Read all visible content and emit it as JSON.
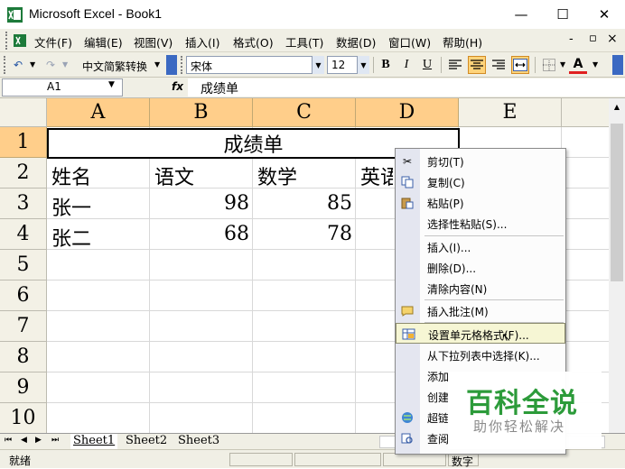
{
  "window": {
    "title": "Microsoft Excel - Book1",
    "min_glyph": "—",
    "max_glyph": "☐",
    "close_glyph": "✕"
  },
  "menu": {
    "items": [
      "文件(F)",
      "编辑(E)",
      "视图(V)",
      "插入(I)",
      "格式(O)",
      "工具(T)",
      "数据(D)",
      "窗口(W)",
      "帮助(H)"
    ],
    "right_controls": [
      "-",
      "▫",
      "×"
    ]
  },
  "toolbar": {
    "conversion_combo": "中文简繁转换",
    "font_name": "宋体",
    "font_size": "12",
    "bold": "B",
    "italic": "I",
    "underline": "U",
    "font_color_glyph": "A"
  },
  "formula_bar": {
    "name_box": "A1",
    "fx": "fx",
    "content": "成绩单"
  },
  "sheet": {
    "columns": [
      "A",
      "B",
      "C",
      "D",
      "E"
    ],
    "rows": [
      "1",
      "2",
      "3",
      "4",
      "5",
      "6",
      "7",
      "8",
      "9",
      "10"
    ],
    "a1_merged": "成绩单",
    "header_row": [
      "姓名",
      "语文",
      "数学",
      "英语"
    ],
    "data_rows": [
      {
        "name": "张一",
        "chinese": "98",
        "math": "85"
      },
      {
        "name": "张二",
        "chinese": "68",
        "math": "78"
      }
    ]
  },
  "context_menu": {
    "items": [
      {
        "label": "剪切(T)",
        "icon": "scissors-icon"
      },
      {
        "label": "复制(C)",
        "icon": "copy-icon"
      },
      {
        "label": "粘贴(P)",
        "icon": "paste-icon"
      },
      {
        "label": "选择性粘贴(S)...",
        "icon": ""
      },
      {
        "label": "插入(I)...",
        "icon": ""
      },
      {
        "label": "删除(D)...",
        "icon": ""
      },
      {
        "label": "清除内容(N)",
        "icon": ""
      },
      {
        "label": "插入批注(M)",
        "icon": "comment-icon"
      },
      {
        "label": "设置单元格格式(F)...",
        "icon": "format-cells-icon"
      },
      {
        "label": "从下拉列表中选择(K)...",
        "icon": ""
      },
      {
        "label": "添加",
        "icon": ""
      },
      {
        "label": "创建",
        "icon": ""
      },
      {
        "label": "超链",
        "icon": "hyperlink-icon"
      },
      {
        "label": "查阅",
        "icon": "lookup-icon"
      }
    ]
  },
  "tabs": {
    "sheets": [
      "Sheet1",
      "Sheet2",
      "Sheet3"
    ],
    "nav": [
      "⏮",
      "◀",
      "▶",
      "⏭"
    ]
  },
  "status": {
    "ready": "就绪",
    "num": "数字"
  },
  "watermark": {
    "title": "百科全说",
    "subtitle": "助你轻松解决"
  },
  "colors": {
    "header_highlight": "#ffce8a",
    "watermark_green": "#2c9b3a",
    "menu_hover": "#f6f6d4"
  }
}
